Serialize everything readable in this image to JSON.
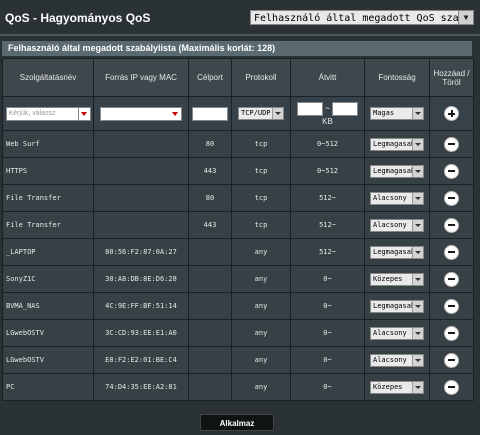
{
  "header": {
    "title": "QoS - Hagyományos QoS",
    "mode": "Felhasználó által megadott QoS szabályok"
  },
  "list": {
    "title": "Felhasználó által megadott szabálylista (Maximális korlát: 128)"
  },
  "columns": [
    "Szolgáltatásnév",
    "Forrás IP vagy MAC",
    "Célport",
    "Protokoll",
    "Átvitt",
    "Fontosság",
    "Hozzáad / Töröl"
  ],
  "input_row": {
    "name_placeholder": "Kérjük, válassz",
    "protocol": "TCP/UDP",
    "transfer_sep": "~",
    "transfer_unit": "KB",
    "priority": "Magas"
  },
  "rows": [
    {
      "name": "Web Surf",
      "source": "",
      "port": "80",
      "protocol": "tcp",
      "transfer": "0~512",
      "priority": "Legmagasabb"
    },
    {
      "name": "HTTPS",
      "source": "",
      "port": "443",
      "protocol": "tcp",
      "transfer": "0~512",
      "priority": "Legmagasabb"
    },
    {
      "name": "File Transfer",
      "source": "",
      "port": "80",
      "protocol": "tcp",
      "transfer": "512~",
      "priority": "Alacsony"
    },
    {
      "name": "File Transfer",
      "source": "",
      "port": "443",
      "protocol": "tcp",
      "transfer": "512~",
      "priority": "Alacsony"
    },
    {
      "name": "_LAPTOP",
      "source": "80:56:F2:87:0A:27",
      "port": "",
      "protocol": "any",
      "transfer": "512~",
      "priority": "Legmagasabb"
    },
    {
      "name": "SonyZ1C",
      "source": "30:A8:DB:8E:D6:28",
      "port": "",
      "protocol": "any",
      "transfer": "0~",
      "priority": "Közepes"
    },
    {
      "name": "BVMA_NAS",
      "source": "4C:9E:FF:BF:51:14",
      "port": "",
      "protocol": "any",
      "transfer": "0~",
      "priority": "Legmagasabb"
    },
    {
      "name": "LGwebOSTV",
      "source": "3C:CD:93:EE:E1:A0",
      "port": "",
      "protocol": "any",
      "transfer": "0~",
      "priority": "Alacsony"
    },
    {
      "name": "LGwebOSTV",
      "source": "E8:F2:E2:01:BE:C4",
      "port": "",
      "protocol": "any",
      "transfer": "0~",
      "priority": "Alacsony"
    },
    {
      "name": "PC",
      "source": "74:D4:35:EE:A2:81",
      "port": "",
      "protocol": "any",
      "transfer": "0~",
      "priority": "Közepes"
    }
  ],
  "apply_label": "Alkalmaz"
}
